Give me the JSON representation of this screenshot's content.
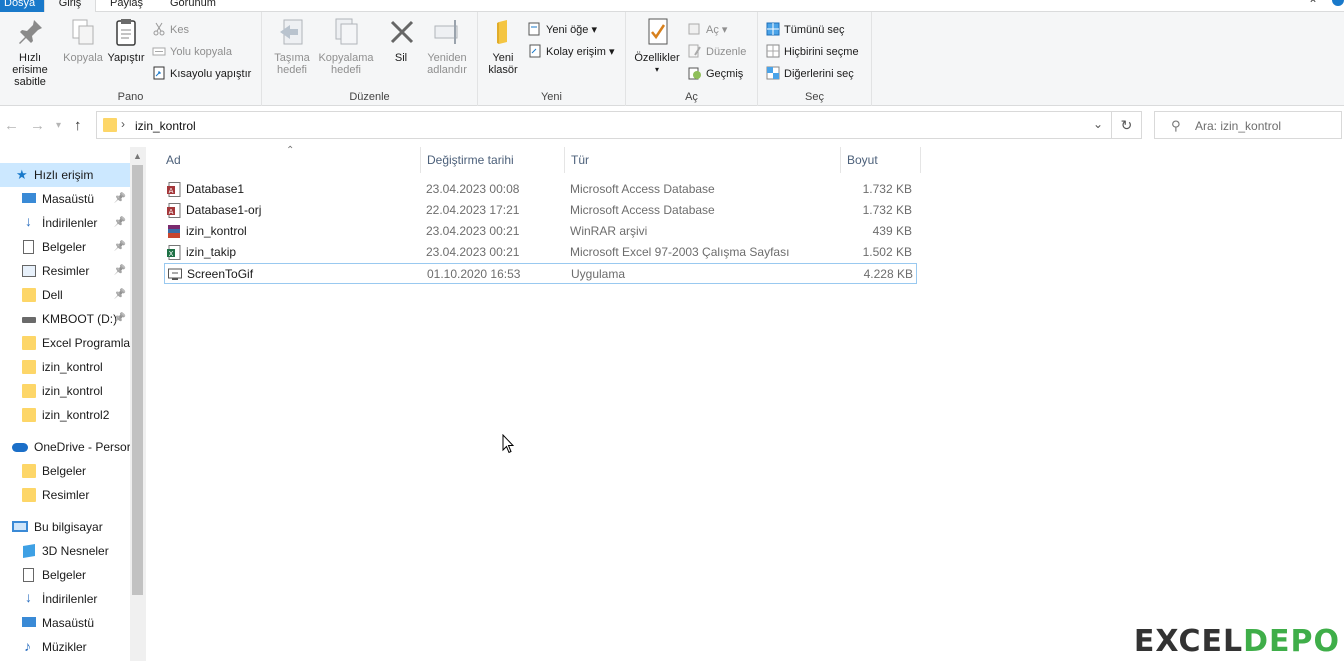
{
  "tabs": {
    "file": "Dosya",
    "home": "Giriş",
    "share": "Paylaş",
    "view": "Görünüm"
  },
  "ribbon": {
    "pano": {
      "label": "Pano",
      "pin_label": "Hızlı erisime sabitle",
      "copy_label": "Kopyala",
      "paste_label": "Yapıştır",
      "cut_label": "Kes",
      "copy_path_label": "Yolu kopyala",
      "paste_shortcut_label": "Kısayolu yapıştır"
    },
    "duzenle": {
      "label": "Düzenle",
      "move_to_label": "Taşıma hedefi",
      "copy_to_label": "Kopyalama hedefi",
      "delete_label": "Sil",
      "rename_label": "Yeniden adlandır"
    },
    "yeni": {
      "label": "Yeni",
      "new_folder_label": "Yeni klasör",
      "new_item_label": "Yeni öğe",
      "easy_access_label": "Kolay erişim"
    },
    "ac": {
      "label": "Aç",
      "properties_label": "Özellikler",
      "open_label": "Aç",
      "edit_label": "Düzenle",
      "history_label": "Geçmiş"
    },
    "sec": {
      "label": "Seç",
      "select_all_label": "Tümünü seç",
      "select_none_label": "Hiçbirini seçme",
      "invert_label": "Diğerlerini seç"
    }
  },
  "address": {
    "path": "izin_kontrol",
    "search_placeholder": "Ara: izin_kontrol"
  },
  "nav": {
    "quick_access": "Hızlı erişim",
    "quick_items": [
      {
        "label": "Masaüstü",
        "icon": "desktop-icon",
        "pinned": true
      },
      {
        "label": "İndirilenler",
        "icon": "download-icon",
        "pinned": true
      },
      {
        "label": "Belgeler",
        "icon": "documents-icon",
        "pinned": true
      },
      {
        "label": "Resimler",
        "icon": "pictures-icon",
        "pinned": true
      },
      {
        "label": "Dell",
        "icon": "folder-icon",
        "pinned": true
      },
      {
        "label": "KMBOOT (D:)",
        "icon": "drive-icon",
        "pinned": true
      },
      {
        "label": "Excel Programla",
        "icon": "folder-icon",
        "pinned": false
      },
      {
        "label": "izin_kontrol",
        "icon": "folder-icon",
        "pinned": false
      },
      {
        "label": "izin_kontrol",
        "icon": "folder-icon",
        "pinned": false
      },
      {
        "label": "izin_kontrol2",
        "icon": "folder-icon",
        "pinned": false
      }
    ],
    "onedrive": "OneDrive - Persor",
    "onedrive_items": [
      {
        "label": "Belgeler",
        "icon": "folder-icon"
      },
      {
        "label": "Resimler",
        "icon": "folder-icon"
      }
    ],
    "this_pc": "Bu bilgisayar",
    "pc_items": [
      {
        "label": "3D Nesneler",
        "icon": "3d-objects-icon"
      },
      {
        "label": "Belgeler",
        "icon": "documents-icon"
      },
      {
        "label": "İndirilenler",
        "icon": "download-icon"
      },
      {
        "label": "Masaüstü",
        "icon": "desktop-icon"
      },
      {
        "label": "Müzikler",
        "icon": "music-icon"
      }
    ]
  },
  "columns": {
    "name": "Ad",
    "modified": "Değiştirme tarihi",
    "type": "Tür",
    "size": "Boyut"
  },
  "files": [
    {
      "name": "Database1",
      "modified": "23.04.2023 00:08",
      "type": "Microsoft Access Database",
      "size": "1.732 KB",
      "icon": "access-file-icon"
    },
    {
      "name": "Database1-orj",
      "modified": "22.04.2023 17:21",
      "type": "Microsoft Access Database",
      "size": "1.732 KB",
      "icon": "access-file-icon"
    },
    {
      "name": "izin_kontrol",
      "modified": "23.04.2023 00:21",
      "type": "WinRAR arşivi",
      "size": "439 KB",
      "icon": "rar-file-icon"
    },
    {
      "name": "izin_takip",
      "modified": "23.04.2023 00:21",
      "type": "Microsoft Excel 97-2003 Çalışma Sayfası",
      "size": "1.502 KB",
      "icon": "excel-file-icon"
    },
    {
      "name": "ScreenToGif",
      "modified": "01.10.2020 16:53",
      "type": "Uygulama",
      "size": "4.228 KB",
      "icon": "app-file-icon"
    }
  ],
  "watermark": {
    "part1": "EXCEL",
    "part2": "DEPO"
  }
}
